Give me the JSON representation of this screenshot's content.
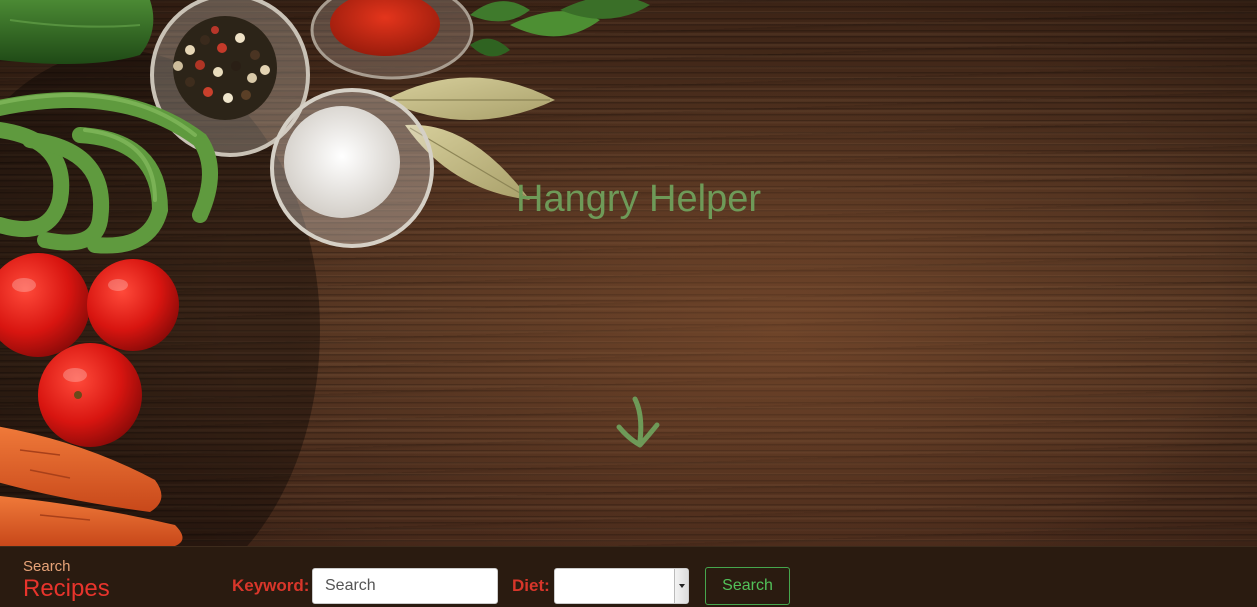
{
  "hero": {
    "title": "Hangry Helper",
    "scroll_icon": "arrow-down-icon",
    "title_color": "#6e9a58"
  },
  "searchbar": {
    "brand_small": "Search",
    "brand_big": "Recipes",
    "keyword_label": "Keyword:",
    "keyword_placeholder": "Search",
    "keyword_value": "",
    "diet_label": "Diet:",
    "diet_value": "",
    "search_button": "Search"
  },
  "colors": {
    "label_red": "#d8362a",
    "brand_red": "#e8342c",
    "button_green": "#52c159",
    "bar_bg": "#2a1b10"
  }
}
